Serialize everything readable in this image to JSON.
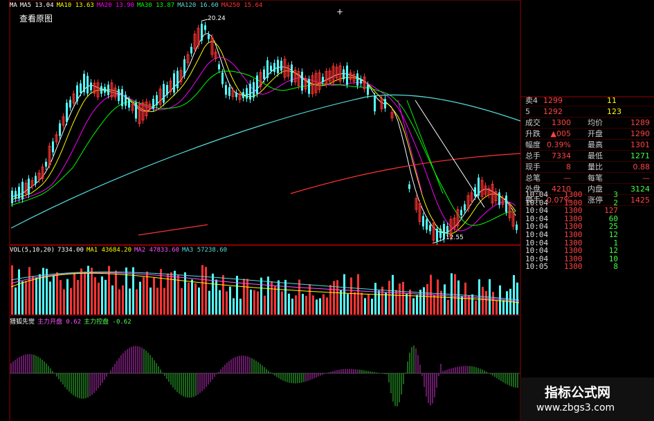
{
  "toolbar": {
    "orig_button": "查看原图"
  },
  "price_header": {
    "items": [
      {
        "label": "MA",
        "color": "#ffffff"
      },
      {
        "label": "MA5 13.04",
        "color": "#ffffff"
      },
      {
        "label": "MA10 13.63",
        "color": "#ffff00"
      },
      {
        "label": "MA20 13.90",
        "color": "#ff00ff"
      },
      {
        "label": "MA30 13.87",
        "color": "#00ff00"
      },
      {
        "label": "MA120 16.60",
        "color": "#55dddd"
      },
      {
        "label": "MA250 15.64",
        "color": "#ff3333"
      }
    ]
  },
  "annotations": {
    "high": "20.24",
    "low": "12.55"
  },
  "vol_header": {
    "items": [
      {
        "label": "VOL(5,10,20)",
        "color": "#ffffff"
      },
      {
        "label": "7334.00",
        "color": "#ffffff"
      },
      {
        "label": "MA1 43684.20",
        "color": "#ffff00"
      },
      {
        "label": "MA2 47833.60",
        "color": "#ff55ff"
      },
      {
        "label": "MA3 57238.60",
        "color": "#55dddd"
      }
    ]
  },
  "ind_header": {
    "items": [
      {
        "label": "猎狐先觉",
        "color": "#ffffff"
      },
      {
        "label": "主力开盘 0.62",
        "color": "#ff55ff"
      },
      {
        "label": "主力控盘 -0.62",
        "color": "#55ff55"
      }
    ]
  },
  "order_book": [
    {
      "label": "卖4",
      "price": "1299",
      "volume": "11"
    },
    {
      "label": "5",
      "price": "1292",
      "volume": "123"
    }
  ],
  "quote": [
    {
      "l1": "成交",
      "v1": "1300",
      "l2": "均价",
      "v2": "1289"
    },
    {
      "l1": "升跌",
      "v1": "▲005",
      "l2": "开盘",
      "v2": "1290"
    },
    {
      "l1": "幅度",
      "v1": "0.39%",
      "l2": "最高",
      "v2": "1301"
    },
    {
      "l1": "总手",
      "v1": "7334",
      "l2": "最低",
      "v2": "1271"
    },
    {
      "l1": "现手",
      "v1": "8",
      "l2": "量比",
      "v2": "0.88"
    },
    {
      "l1": "总笔",
      "v1": "—",
      "l2": "每笔",
      "v2": "—"
    },
    {
      "l1": "外盘",
      "v1": "4210",
      "l2": "内盘",
      "v2": "3124"
    },
    {
      "l1": "换手",
      "v1": "0.07%",
      "l2": "涨停",
      "v2": "1425"
    }
  ],
  "ticks": [
    {
      "time": "10:04",
      "price": "1300",
      "vol": "3",
      "dir": "sell"
    },
    {
      "time": "10:04",
      "price": "1300",
      "vol": "2",
      "dir": "sell"
    },
    {
      "time": "10:04",
      "price": "1300",
      "vol": "127",
      "dir": "buy"
    },
    {
      "time": "10:04",
      "price": "1300",
      "vol": "60",
      "dir": "sell"
    },
    {
      "time": "10:04",
      "price": "1300",
      "vol": "25",
      "dir": "sell"
    },
    {
      "time": "10:04",
      "price": "1300",
      "vol": "12",
      "dir": "sell"
    },
    {
      "time": "10:04",
      "price": "1300",
      "vol": "1",
      "dir": "sell"
    },
    {
      "time": "10:04",
      "price": "1300",
      "vol": "12",
      "dir": "sell"
    },
    {
      "time": "10:04",
      "price": "1300",
      "vol": "10",
      "dir": "sell"
    },
    {
      "time": "10:05",
      "price": "1300",
      "vol": "8",
      "dir": "sell"
    }
  ],
  "watermark": {
    "title": "指标公式网",
    "url": "www.zbgs3.com"
  },
  "colors": {
    "up": "#ff3333",
    "down": "#55ffff",
    "osc_pos": "#cc33cc",
    "osc_neg": "#33cc33",
    "frame": "#990000"
  }
}
